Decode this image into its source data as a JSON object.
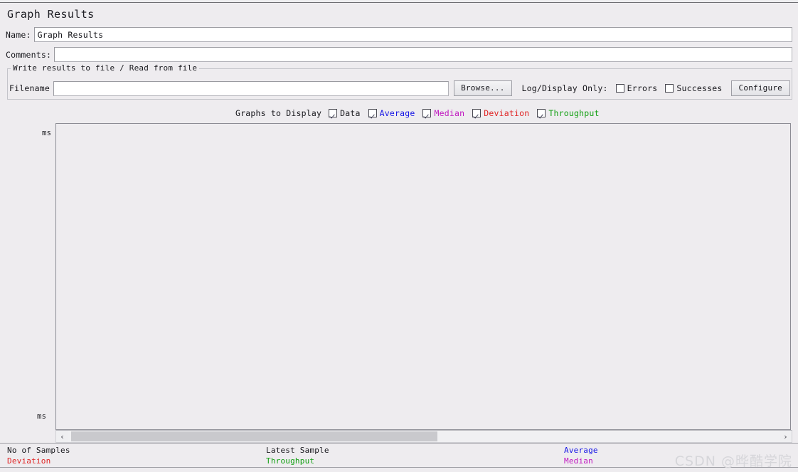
{
  "window": {
    "title": "Graph Results"
  },
  "form": {
    "name_label": "Name:",
    "name_value": "Graph Results",
    "name_placeholder": "",
    "comments_label": "Comments:",
    "comments_value": "",
    "comments_placeholder": ""
  },
  "file_panel": {
    "group_title": "Write results to file / Read from file",
    "filename_label": "Filename",
    "filename_value": "",
    "filename_placeholder": "",
    "browse_label": "Browse...",
    "log_display_label": "Log/Display Only:",
    "errors": {
      "label": "Errors",
      "checked": false
    },
    "successes": {
      "label": "Successes",
      "checked": false
    },
    "configure_label": "Configure"
  },
  "graphs_to_display": {
    "label": "Graphs to Display",
    "options": [
      {
        "label": "Data",
        "checked": true,
        "color": "#17171c"
      },
      {
        "label": "Average",
        "checked": true,
        "color": "#1414e6"
      },
      {
        "label": "Median",
        "checked": true,
        "color": "#c016c0"
      },
      {
        "label": "Deviation",
        "checked": true,
        "color": "#e02424"
      },
      {
        "label": "Throughput",
        "checked": true,
        "color": "#13a013"
      }
    ]
  },
  "graph": {
    "axis_unit_top": "ms",
    "axis_unit_bottom": "ms",
    "background_color": "#eeecef",
    "border_color": "#8c8c94"
  },
  "scrollbar": {
    "left_arrow": "‹",
    "right_arrow": "›"
  },
  "legend": {
    "column1": [
      {
        "label": "No of Samples",
        "color": "#17171c"
      },
      {
        "label": "Deviation",
        "color": "#e02424"
      }
    ],
    "column2": [
      {
        "label": "Latest Sample",
        "color": "#17171c"
      },
      {
        "label": "Throughput",
        "color": "#13a013"
      }
    ],
    "column3": [
      {
        "label": "Average",
        "color": "#1414e6"
      },
      {
        "label": "Median",
        "color": "#c016c0"
      }
    ]
  },
  "watermark": {
    "text": "CSDN @晔酷学院"
  }
}
